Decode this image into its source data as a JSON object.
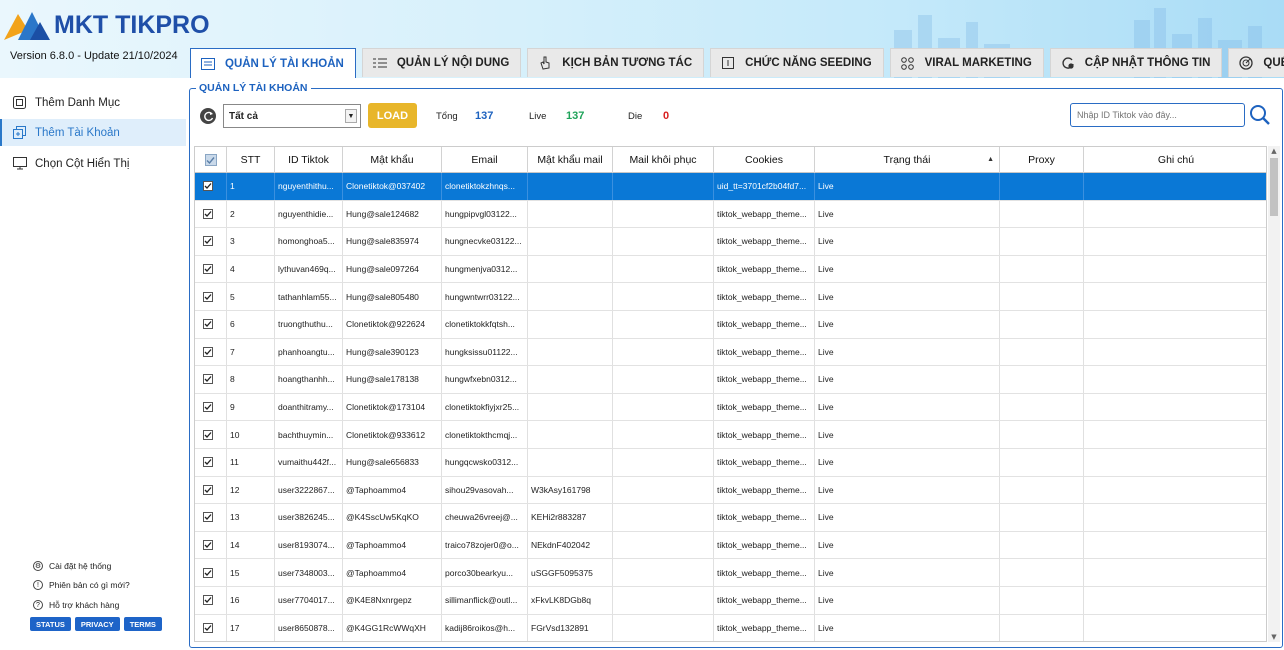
{
  "app": {
    "logo_text": "MKT TIKPRO",
    "version_text": "Version  6.8.0  - Update  21/10/2024"
  },
  "tabs": [
    {
      "label": "QUẢN LÝ TÀI KHOẢN",
      "icon": "account-list-icon",
      "active": true
    },
    {
      "label": "QUẢN LÝ NỘI DUNG",
      "icon": "content-list-icon"
    },
    {
      "label": "KỊCH BẢN TƯƠNG TÁC",
      "icon": "hand-pointer-icon"
    },
    {
      "label": "CHỨC NĂNG SEEDING",
      "icon": "seeding-icon"
    },
    {
      "label": "VIRAL MARKETING",
      "icon": "viral-icon"
    },
    {
      "label": "CẬP NHẬT THÔNG TIN",
      "icon": "update-info-icon"
    },
    {
      "label": "QUÉT DỮ LIỆU",
      "icon": "scan-data-icon"
    }
  ],
  "sidebar": {
    "items": [
      {
        "label": "Thêm Danh Mục",
        "icon": "category-icon"
      },
      {
        "label": "Thêm Tài Khoản",
        "icon": "add-account-icon",
        "active": true
      },
      {
        "label": "Chọn Cột Hiển Thị",
        "icon": "monitor-icon"
      }
    ],
    "footer": [
      {
        "label": "Cài đặt hệ thống",
        "icon": "gear-icon"
      },
      {
        "label": "Phiên bản có gì mới?",
        "icon": "info-icon"
      },
      {
        "label": "Hỗ trợ khách hàng",
        "icon": "help-icon"
      }
    ],
    "buttons": [
      "STATUS",
      "PRIVACY",
      "TERMS"
    ]
  },
  "panel": {
    "title": "QUẢN LÝ TÀI KHOẢN",
    "filter_value": "Tất cả",
    "load_label": "LOAD",
    "total_label": "Tổng",
    "total_value": "137",
    "live_label": "Live",
    "live_value": "137",
    "die_label": "Die",
    "die_value": "0",
    "search_placeholder": "Nhập ID Tiktok vào đây...",
    "colors": {
      "total": "#1d62bf",
      "live": "#1fa35a",
      "die": "#d92020",
      "load": "#e8b62a",
      "accent": "#2a6cc4"
    }
  },
  "table": {
    "columns": [
      "",
      "STT",
      "ID Tiktok",
      "Mật khẩu",
      "Email",
      "Mật khẩu mail",
      "Mail khôi phục",
      "Cookies",
      "Trạng thái",
      "Proxy",
      "Ghi chú"
    ],
    "rows": [
      [
        "1",
        "nguyenthithu...",
        "Clonetiktok@037402",
        "clonetiktokzhnqs...",
        "",
        "",
        "uid_tt=3701cf2b04fd7...",
        "Live",
        "",
        ""
      ],
      [
        "2",
        "nguyenthidie...",
        "Hung@sale124682",
        "hungpipvgl03122...",
        "",
        "",
        "tiktok_webapp_theme...",
        "Live",
        "",
        ""
      ],
      [
        "3",
        "homonghoa5...",
        "Hung@sale835974",
        "hungnecvke03122...",
        "",
        "",
        "tiktok_webapp_theme...",
        "Live",
        "",
        ""
      ],
      [
        "4",
        "lythuvan469q...",
        "Hung@sale097264",
        "hungmenjva0312...",
        "",
        "",
        "tiktok_webapp_theme...",
        "Live",
        "",
        ""
      ],
      [
        "5",
        "tathanhlam55...",
        "Hung@sale805480",
        "hungwntwrr03122...",
        "",
        "",
        "tiktok_webapp_theme...",
        "Live",
        "",
        ""
      ],
      [
        "6",
        "truongthuthu...",
        "Clonetiktok@922624",
        "clonetiktokkfqtsh...",
        "",
        "",
        "tiktok_webapp_theme...",
        "Live",
        "",
        ""
      ],
      [
        "7",
        "phanhoangtu...",
        "Hung@sale390123",
        "hungksissu01122...",
        "",
        "",
        "tiktok_webapp_theme...",
        "Live",
        "",
        ""
      ],
      [
        "8",
        "hoangthanhh...",
        "Hung@sale178138",
        "hungwfxebn0312...",
        "",
        "",
        "tiktok_webapp_theme...",
        "Live",
        "",
        ""
      ],
      [
        "9",
        "doanthitramy...",
        "Clonetiktok@173104",
        "clonetiktokfiyjxr25...",
        "",
        "",
        "tiktok_webapp_theme...",
        "Live",
        "",
        ""
      ],
      [
        "10",
        "bachthuymin...",
        "Clonetiktok@933612",
        "clonetiktokthcmqj...",
        "",
        "",
        "tiktok_webapp_theme...",
        "Live",
        "",
        ""
      ],
      [
        "11",
        "vumaithu442f...",
        "Hung@sale656833",
        "hungqcwsko0312...",
        "",
        "",
        "tiktok_webapp_theme...",
        "Live",
        "",
        ""
      ],
      [
        "12",
        "user3222867...",
        "@Taphoammo4",
        "sihou29vasovah...",
        "W3kAsy161798",
        "",
        "tiktok_webapp_theme...",
        "Live",
        "",
        ""
      ],
      [
        "13",
        "user3826245...",
        "@K4SscUw5KqKO",
        "cheuwa26vreej@...",
        "KEHi2r883287",
        "",
        "tiktok_webapp_theme...",
        "Live",
        "",
        ""
      ],
      [
        "14",
        "user8193074...",
        "@Taphoammo4",
        "traico78zojer0@o...",
        "NEkdnF402042",
        "",
        "tiktok_webapp_theme...",
        "Live",
        "",
        ""
      ],
      [
        "15",
        "user7348003...",
        "@Taphoammo4",
        "porco30bearkyu...",
        "uSGGF5095375",
        "",
        "tiktok_webapp_theme...",
        "Live",
        "",
        ""
      ],
      [
        "16",
        "user7704017...",
        "@K4E8Nxnrgepz",
        "sillimanflick@outl...",
        "xFkvLK8DGb8q",
        "",
        "tiktok_webapp_theme...",
        "Live",
        "",
        ""
      ],
      [
        "17",
        "user8650878...",
        "@K4GG1RcWWqXH",
        "kadij86roikos@h...",
        "FGrVsd132891",
        "",
        "tiktok_webapp_theme...",
        "Live",
        "",
        ""
      ]
    ]
  }
}
